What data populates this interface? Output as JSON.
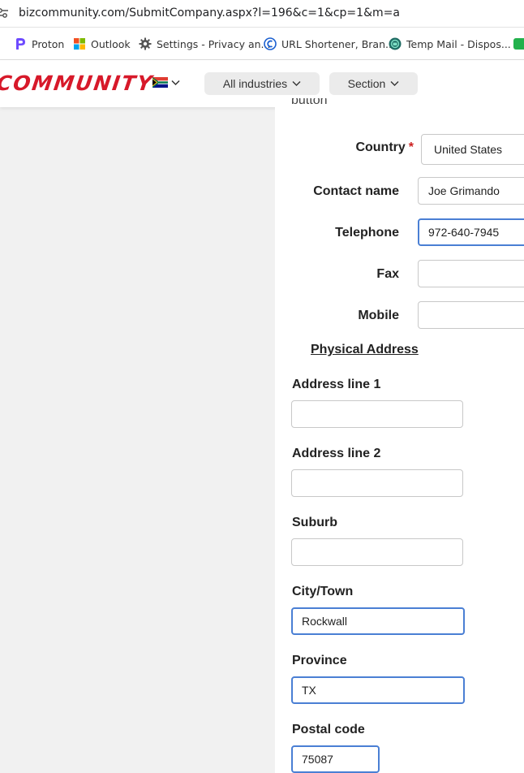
{
  "browser": {
    "url": "bizcommunity.com/SubmitCompany.aspx?l=196&c=1&cp=1&m=a",
    "bookmarks": [
      {
        "label": "Proton",
        "icon": "proton-icon"
      },
      {
        "label": "Outlook",
        "icon": "outlook-icon"
      },
      {
        "label": "Settings - Privacy an...",
        "icon": "gear-icon"
      },
      {
        "label": "URL Shortener, Bran...",
        "icon": "url-shortener-icon"
      },
      {
        "label": "Temp Mail - Dispos...",
        "icon": "temp-mail-icon"
      }
    ]
  },
  "header": {
    "logo_text": "COMMUNITY",
    "industries_label": "All industries",
    "section_label": "Section",
    "colors": {
      "brand": "#d7192a"
    }
  },
  "form": {
    "cut_text": "button",
    "country": {
      "label": "Country",
      "required_mark": "*",
      "value": "United States"
    },
    "contact_name": {
      "label": "Contact name",
      "value": "Joe Grimando"
    },
    "telephone": {
      "label": "Telephone",
      "value": "972-640-7945"
    },
    "fax": {
      "label": "Fax",
      "value": ""
    },
    "mobile": {
      "label": "Mobile",
      "value": ""
    },
    "physical_address_heading": "Physical Address",
    "address_line_1": {
      "label": "Address line 1",
      "value": ""
    },
    "address_line_2": {
      "label": "Address line 2",
      "value": ""
    },
    "suburb": {
      "label": "Suburb",
      "value": ""
    },
    "city": {
      "label": "City/Town",
      "value": "Rockwall"
    },
    "province": {
      "label": "Province",
      "value": "TX"
    },
    "postal_code": {
      "label": "Postal code",
      "value": "75087"
    }
  }
}
